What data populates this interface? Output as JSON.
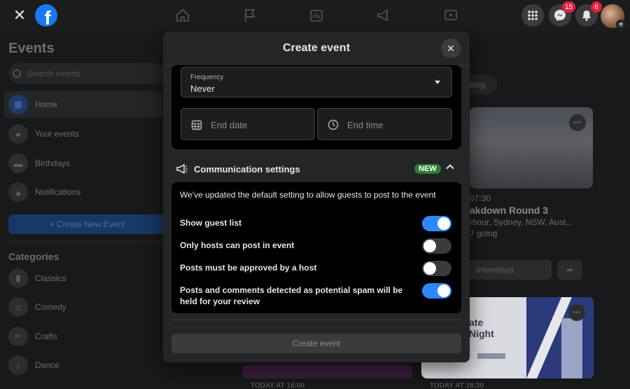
{
  "topbar": {
    "close_glyph": "✕",
    "logo_letter": "f",
    "messenger_badge": "15",
    "notifications_badge": "6"
  },
  "sidebar": {
    "title": "Events",
    "search_placeholder": "Search events",
    "items": [
      {
        "label": "Home",
        "icon": "calendar-icon"
      },
      {
        "label": "Your events",
        "icon": "person-icon"
      },
      {
        "label": "Birthdays",
        "icon": "cake-icon"
      },
      {
        "label": "Notifications",
        "icon": "bell-icon"
      }
    ],
    "create_label": "+ Create New Event",
    "categories_title": "Categories",
    "categories": [
      {
        "label": "Classics",
        "icon": "book-icon"
      },
      {
        "label": "Comedy",
        "icon": "smile-icon"
      },
      {
        "label": "Crafts",
        "icon": "scissors-icon"
      },
      {
        "label": "Dance",
        "icon": "dance-icon"
      }
    ]
  },
  "content": {
    "chip_label": "wing",
    "card1": {
      "time": "07:30",
      "title": "akdown Round 3",
      "location": "rbour, Sydney, NSW, Aust...",
      "going": "7 going"
    },
    "interested_label": "Interested",
    "card2": {
      "line1": "ate",
      "line2": "Night"
    },
    "bottom_left": "TODAY AT 18:00",
    "bottom_right": "TODAY AT 18:30"
  },
  "modal": {
    "title": "Create event",
    "frequency": {
      "label": "Frequency",
      "value": "Never"
    },
    "end_date_placeholder": "End date",
    "end_time_placeholder": "End time",
    "comm": {
      "title": "Communication settings",
      "new_badge": "NEW",
      "description": "We've updated the default setting to allow guests to post to the event",
      "settings": [
        {
          "label": "Show guest list",
          "on": true
        },
        {
          "label": "Only hosts can post in event",
          "on": false
        },
        {
          "label": "Posts must be approved by a host",
          "on": false
        },
        {
          "label": "Posts and comments detected as potential spam will be held for your review",
          "on": true
        }
      ]
    },
    "create_button": "Create event"
  },
  "colors": {
    "accent": "#2d88ff",
    "brand": "#1877f2",
    "new_badge": "#2e7d32",
    "badge_red": "#e41e3f"
  }
}
